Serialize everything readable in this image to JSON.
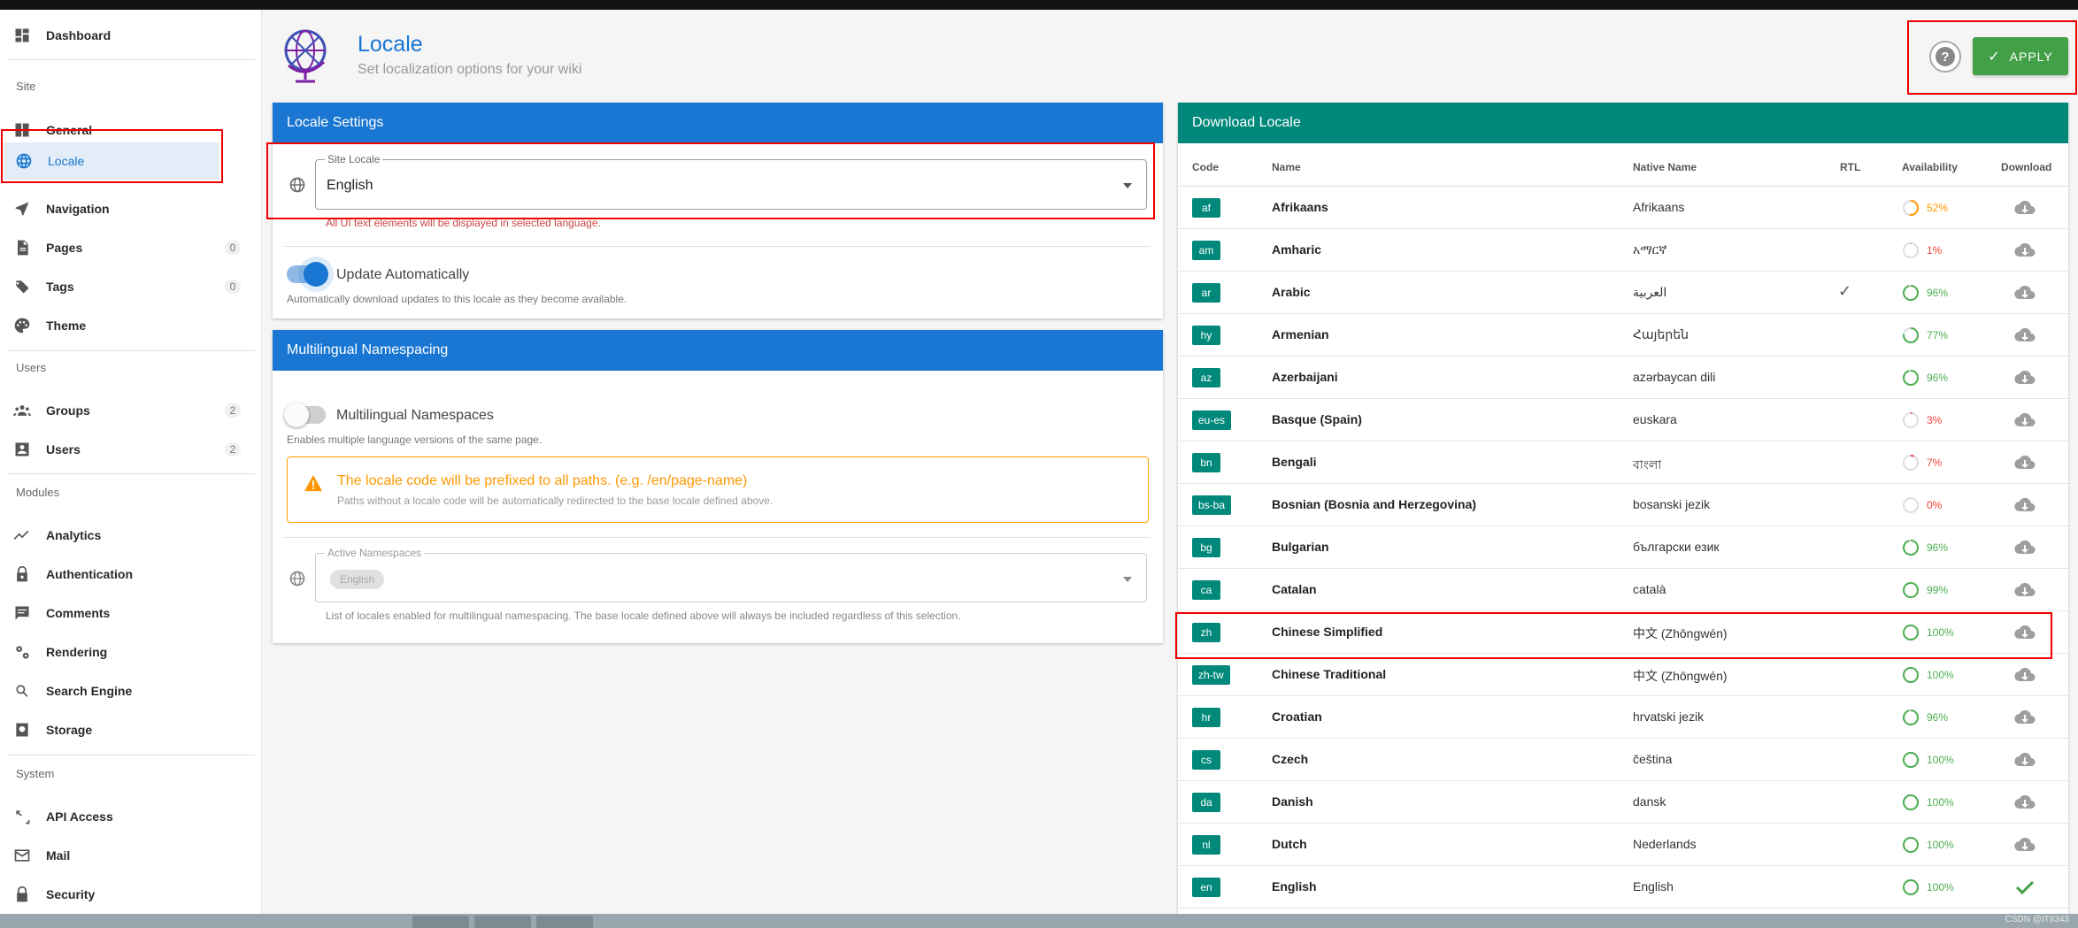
{
  "sidebar": {
    "dashboard": "Dashboard",
    "section_site": "Site",
    "general": "General",
    "locale": "Locale",
    "navigation": "Navigation",
    "pages": "Pages",
    "pages_count": "0",
    "tags": "Tags",
    "tags_count": "0",
    "theme": "Theme",
    "section_users": "Users",
    "groups": "Groups",
    "groups_count": "2",
    "users": "Users",
    "users_count": "2",
    "section_modules": "Modules",
    "analytics": "Analytics",
    "authentication": "Authentication",
    "comments": "Comments",
    "rendering": "Rendering",
    "search_engine": "Search Engine",
    "storage": "Storage",
    "section_system": "System",
    "api_access": "API Access",
    "mail": "Mail",
    "security": "Security"
  },
  "header": {
    "title": "Locale",
    "subtitle": "Set localization options for your wiki",
    "help_icon": "question-circle-icon",
    "apply_label": "APPLY",
    "apply_color": "#43a047"
  },
  "locale_settings": {
    "title": "Locale Settings",
    "site_locale_label": "Site Locale",
    "site_locale_value": "English",
    "site_locale_hint": "All UI text elements will be displayed in selected language.",
    "update_auto_label": "Update Automatically",
    "update_auto_enabled": true,
    "update_auto_hint": "Automatically download updates to this locale as they become available."
  },
  "namespacing": {
    "title": "Multilingual Namespacing",
    "toggle_label": "Multilingual Namespaces",
    "toggle_enabled": false,
    "toggle_hint": "Enables multiple language versions of the same page.",
    "alert_title": "The locale code will be prefixed to all paths. (e.g. /en/page-name)",
    "alert_subtitle": "Paths without a locale code will be automatically redirected to the base locale defined above.",
    "active_label": "Active Namespaces",
    "active_chip": "English",
    "active_hint": "List of locales enabled for multilingual namespacing. The base locale defined above will always be included regardless of this selection."
  },
  "download": {
    "title": "Download Locale",
    "headers": {
      "code": "Code",
      "name": "Name",
      "native": "Native Name",
      "rtl": "RTL",
      "availability": "Availability",
      "download": "Download"
    },
    "rows": [
      {
        "code": "af",
        "name": "Afrikaans",
        "native": "Afrikaans",
        "rtl": "",
        "pct": "52%",
        "level": 0.52,
        "color": "#ff9800",
        "installed": false
      },
      {
        "code": "am",
        "name": "Amharic",
        "native": "አማርኛ",
        "rtl": "",
        "pct": "1%",
        "level": 0.01,
        "color": "#f44336",
        "installed": false
      },
      {
        "code": "ar",
        "name": "Arabic",
        "native": "العربية",
        "rtl": "✓",
        "pct": "96%",
        "level": 0.96,
        "color": "#4caf50",
        "installed": false
      },
      {
        "code": "hy",
        "name": "Armenian",
        "native": "Հայերեն",
        "rtl": "",
        "pct": "77%",
        "level": 0.77,
        "color": "#4caf50",
        "installed": false
      },
      {
        "code": "az",
        "name": "Azerbaijani",
        "native": "azərbaycan dili",
        "rtl": "",
        "pct": "96%",
        "level": 0.96,
        "color": "#4caf50",
        "installed": false
      },
      {
        "code": "eu-es",
        "name": "Basque (Spain)",
        "native": "euskara",
        "rtl": "",
        "pct": "3%",
        "level": 0.03,
        "color": "#f44336",
        "installed": false
      },
      {
        "code": "bn",
        "name": "Bengali",
        "native": "বাংলা",
        "rtl": "",
        "pct": "7%",
        "level": 0.07,
        "color": "#f44336",
        "installed": false
      },
      {
        "code": "bs-ba",
        "name": "Bosnian (Bosnia and Herzegovina)",
        "native": "bosanski jezik",
        "rtl": "",
        "pct": "0%",
        "level": 0.0,
        "color": "#f44336",
        "installed": false
      },
      {
        "code": "bg",
        "name": "Bulgarian",
        "native": "български език",
        "rtl": "",
        "pct": "96%",
        "level": 0.96,
        "color": "#4caf50",
        "installed": false
      },
      {
        "code": "ca",
        "name": "Catalan",
        "native": "català",
        "rtl": "",
        "pct": "99%",
        "level": 0.99,
        "color": "#4caf50",
        "installed": false
      },
      {
        "code": "zh",
        "name": "Chinese Simplified",
        "native": "中文 (Zhōngwén)",
        "rtl": "",
        "pct": "100%",
        "level": 1.0,
        "color": "#4caf50",
        "installed": false
      },
      {
        "code": "zh-tw",
        "name": "Chinese Traditional",
        "native": "中文 (Zhōngwén)",
        "rtl": "",
        "pct": "100%",
        "level": 1.0,
        "color": "#4caf50",
        "installed": false
      },
      {
        "code": "hr",
        "name": "Croatian",
        "native": "hrvatski jezik",
        "rtl": "",
        "pct": "96%",
        "level": 0.96,
        "color": "#4caf50",
        "installed": false
      },
      {
        "code": "cs",
        "name": "Czech",
        "native": "čeština",
        "rtl": "",
        "pct": "100%",
        "level": 1.0,
        "color": "#4caf50",
        "installed": false
      },
      {
        "code": "da",
        "name": "Danish",
        "native": "dansk",
        "rtl": "",
        "pct": "100%",
        "level": 1.0,
        "color": "#4caf50",
        "installed": false
      },
      {
        "code": "nl",
        "name": "Dutch",
        "native": "Nederlands",
        "rtl": "",
        "pct": "100%",
        "level": 1.0,
        "color": "#4caf50",
        "installed": false
      },
      {
        "code": "en",
        "name": "English",
        "native": "English",
        "rtl": "",
        "pct": "100%",
        "level": 1.0,
        "color": "#4caf50",
        "installed": true
      }
    ]
  },
  "watermark": "CSDN @IT8343"
}
